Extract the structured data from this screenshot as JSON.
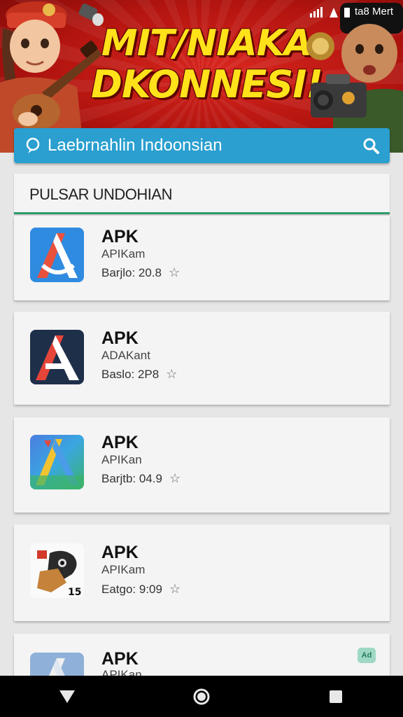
{
  "banner": {
    "line1": "MIT/NIAKA",
    "line2": "DKONNESI!"
  },
  "status_bar": {
    "text": "ta8 Mert"
  },
  "search": {
    "query": "Laebrnahlin Indoonsian"
  },
  "section": {
    "title": "PULSAR UNDOHIAN"
  },
  "apps": [
    {
      "title": "APK",
      "subtitle": "APIKam",
      "meta": "Barjlo: 20.8",
      "icon": "apk-blue-a-icon"
    },
    {
      "title": "APK",
      "subtitle": "ADAKant",
      "meta": "Baslo: 2P8",
      "icon": "apk-navy-a-icon"
    },
    {
      "title": "APK",
      "subtitle": "APIKan",
      "meta": "Barjtb: 04.9",
      "icon": "apk-gradient-a-icon"
    },
    {
      "title": "APK",
      "subtitle": "APIKam",
      "meta": "Eatgo: 9:09",
      "icon": "apk-animal-icon"
    },
    {
      "title": "APK",
      "subtitle": "APIKan",
      "meta": "",
      "icon": "apk-pale-a-icon",
      "badge": "Ad"
    }
  ],
  "nav": {
    "back": "back-icon",
    "home": "home-icon",
    "recents": "recents-icon"
  }
}
